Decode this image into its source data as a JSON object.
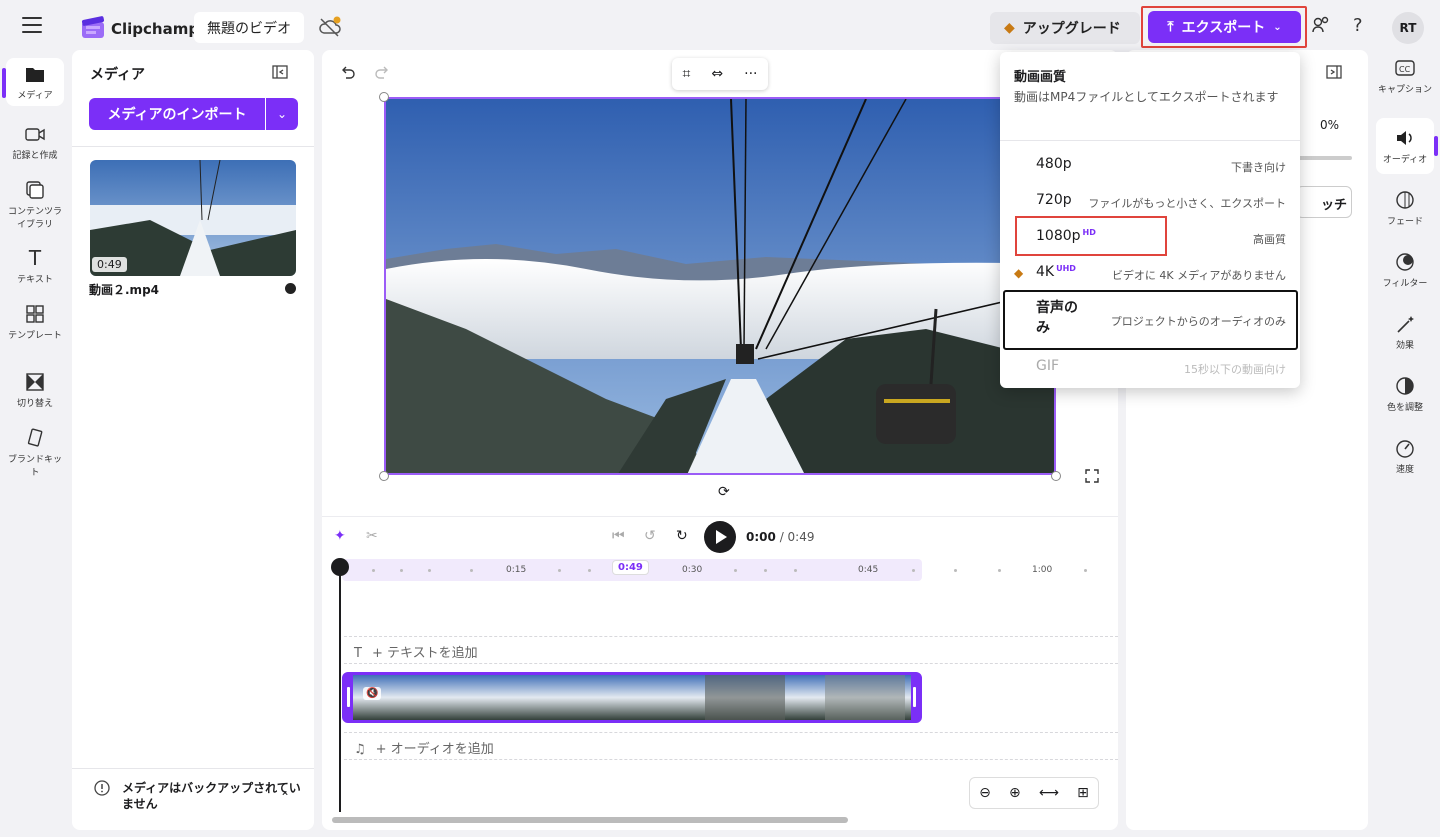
{
  "app": {
    "brand": "Clipchamp",
    "project_title": "無題のビデオ"
  },
  "topbar": {
    "upgrade_label": "アップグレード",
    "export_label": "エクスポート",
    "avatar_initials": "RT",
    "help_label": "?"
  },
  "left_nav": [
    {
      "label": "メディア",
      "icon": "folder-icon"
    },
    {
      "label": "記録と作成",
      "icon": "camera-icon"
    },
    {
      "label": "コンテンツライブラリ",
      "icon": "library-icon"
    },
    {
      "label": "テキスト",
      "icon": "text-icon"
    },
    {
      "label": "テンプレート",
      "icon": "template-icon"
    },
    {
      "label": "切り替え",
      "icon": "transition-icon"
    },
    {
      "label": "ブランドキット",
      "icon": "brandkit-icon"
    }
  ],
  "media_panel": {
    "title": "メディア",
    "import_label": "メディアのインポート",
    "item": {
      "duration": "0:49",
      "filename": "動画２.mp4"
    },
    "backup_notice": "メディアはバックアップされていません"
  },
  "player": {
    "current_time": "0:00",
    "total_time": "/ 0:49"
  },
  "timeline": {
    "ticks": [
      "0:15",
      "0:30",
      "0:45",
      "1:00"
    ],
    "playhead_label": "0:49",
    "text_track": "+ テキストを追加",
    "audio_track": "+ オーディオを追加"
  },
  "right_panel": {
    "percent": "0%",
    "button_partial": "ッチ"
  },
  "right_nav": [
    {
      "label": "キャプション",
      "icon": "captions-icon"
    },
    {
      "label": "オーディオ",
      "icon": "speaker-icon"
    },
    {
      "label": "フェード",
      "icon": "fade-icon"
    },
    {
      "label": "フィルター",
      "icon": "filter-icon"
    },
    {
      "label": "効果",
      "icon": "effects-icon"
    },
    {
      "label": "色を調整",
      "icon": "color-icon"
    },
    {
      "label": "速度",
      "icon": "speed-icon"
    }
  ],
  "export_menu": {
    "title": "動画画質",
    "subtitle": "動画はMP4ファイルとしてエクスポートされます",
    "options": [
      {
        "label": "480p",
        "desc": "下書き向け",
        "badge": ""
      },
      {
        "label": "720p",
        "desc": "ファイルがもっと小さく、エクスポート",
        "badge": ""
      },
      {
        "label": "1080p",
        "desc": "高画質",
        "badge": "HD"
      },
      {
        "label": "4K",
        "desc": "ビデオに 4K メディアがありません",
        "badge": "UHD"
      },
      {
        "label": "音声のみ",
        "desc": "プロジェクトからのオーディオのみ",
        "badge": ""
      },
      {
        "label": "GIF",
        "desc": "15秒以下の動画向け",
        "badge": ""
      }
    ]
  },
  "colors": {
    "accent": "#7b2ff7",
    "highlight": "#e0443c"
  }
}
